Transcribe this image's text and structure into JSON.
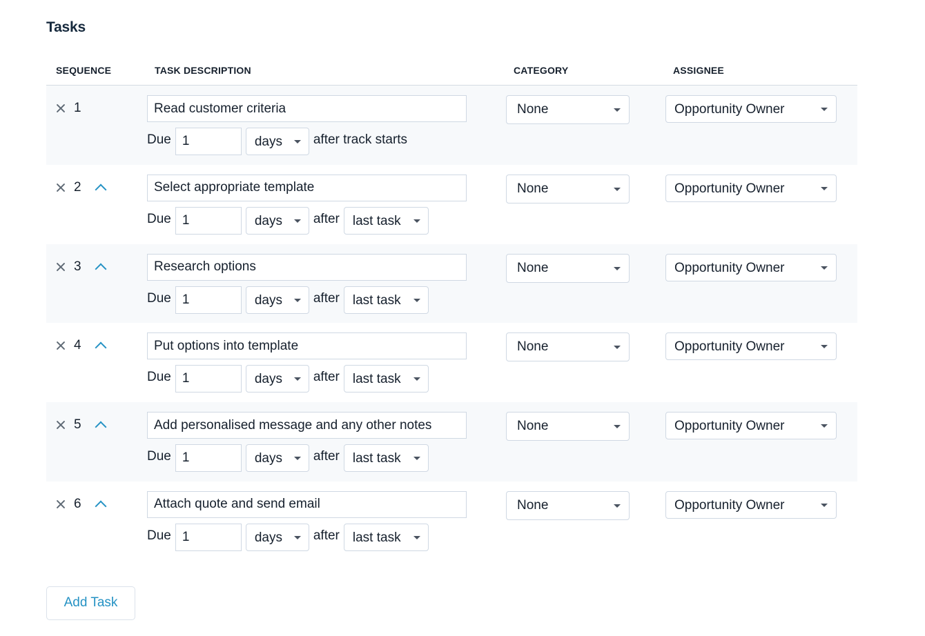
{
  "section": {
    "title": "Tasks"
  },
  "columns": {
    "sequence": "SEQUENCE",
    "description": "TASK DESCRIPTION",
    "category": "CATEGORY",
    "assignee": "ASSIGNEE"
  },
  "labels": {
    "due": "Due",
    "after": "after"
  },
  "tasks": [
    {
      "seq": "1",
      "description": "Read customer criteria",
      "due_value": "1",
      "unit": "days",
      "after_text": "after track starts",
      "reference": null,
      "category": "None",
      "assignee": "Opportunity Owner",
      "can_move_up": false
    },
    {
      "seq": "2",
      "description": "Select appropriate template",
      "due_value": "1",
      "unit": "days",
      "after_text": "after",
      "reference": "last task",
      "category": "None",
      "assignee": "Opportunity Owner",
      "can_move_up": true
    },
    {
      "seq": "3",
      "description": "Research options",
      "due_value": "1",
      "unit": "days",
      "after_text": "after",
      "reference": "last task",
      "category": "None",
      "assignee": "Opportunity Owner",
      "can_move_up": true
    },
    {
      "seq": "4",
      "description": "Put options into template",
      "due_value": "1",
      "unit": "days",
      "after_text": "after",
      "reference": "last task",
      "category": "None",
      "assignee": "Opportunity Owner",
      "can_move_up": true
    },
    {
      "seq": "5",
      "description": "Add personalised message and any other notes",
      "due_value": "1",
      "unit": "days",
      "after_text": "after",
      "reference": "last task",
      "category": "None",
      "assignee": "Opportunity Owner",
      "can_move_up": true
    },
    {
      "seq": "6",
      "description": "Attach quote and send email",
      "due_value": "1",
      "unit": "days",
      "after_text": "after",
      "reference": "last task",
      "category": "None",
      "assignee": "Opportunity Owner",
      "can_move_up": true
    }
  ],
  "actions": {
    "add_task": "Add Task"
  },
  "icons": {
    "remove": "close-icon",
    "move_up": "chevron-up-icon",
    "dropdown": "caret-down-icon"
  },
  "colors": {
    "accent": "#2592c4",
    "text": "#16202d",
    "row_alt_bg": "#f7f9fb",
    "border": "#cfd8e3"
  }
}
